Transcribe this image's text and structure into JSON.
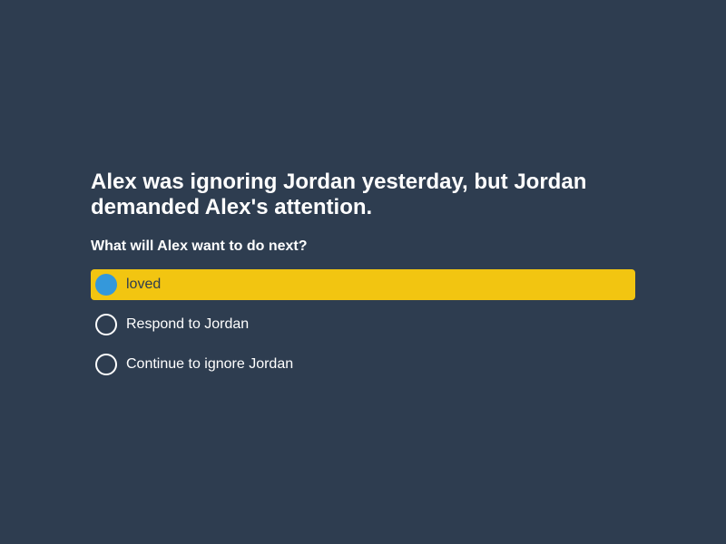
{
  "question": "Alex was ignoring Jordan yesterday, but Jordan demanded Alex's attention.",
  "prompt": "What will Alex want to do next?",
  "options": [
    {
      "label": "loved",
      "selected": true
    },
    {
      "label": "Respond to Jordan",
      "selected": false
    },
    {
      "label": "Continue to ignore Jordan",
      "selected": false
    }
  ],
  "colors": {
    "background": "#2e3d50",
    "selected_highlight": "#f2c511",
    "selected_radio": "#3498db",
    "text": "#ffffff"
  }
}
